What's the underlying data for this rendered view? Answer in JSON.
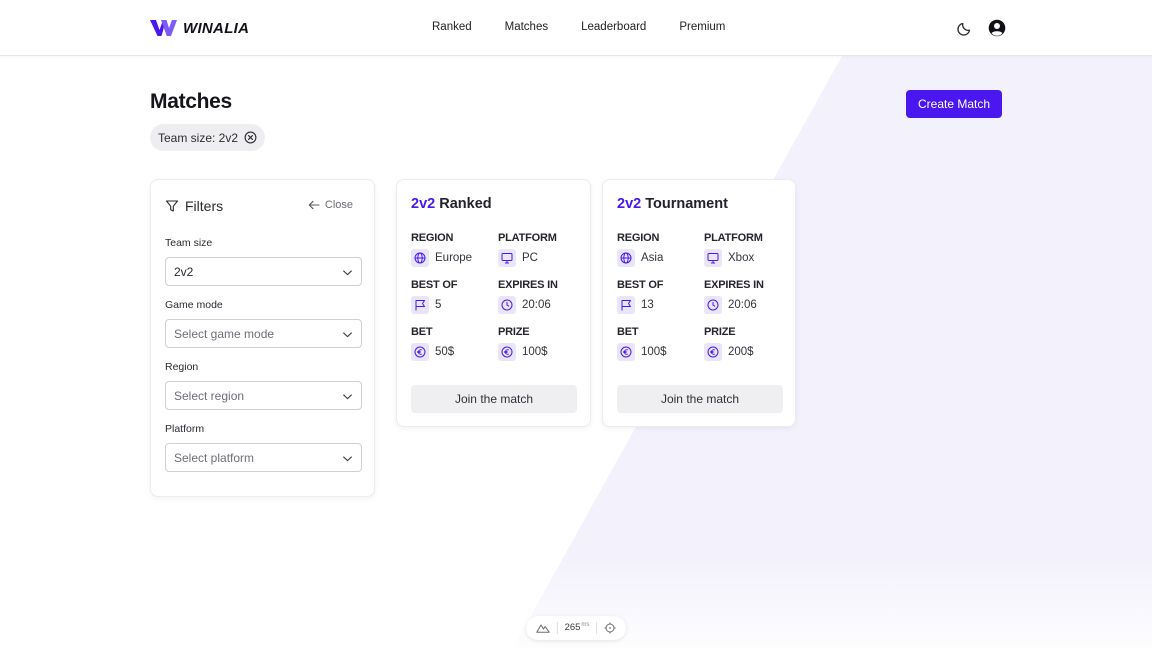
{
  "brand": {
    "name": "WINALIA",
    "accent": "#4a17f0"
  },
  "nav": {
    "items": [
      {
        "label": "Ranked"
      },
      {
        "label": "Matches"
      },
      {
        "label": "Leaderboard"
      },
      {
        "label": "Premium"
      }
    ],
    "active": "Matches"
  },
  "header_icons": [
    "moon-icon",
    "user-account-icon"
  ],
  "page": {
    "title": "Matches",
    "create_button": "Create Match",
    "active_filter_chip": "Team size: 2v2"
  },
  "filters": {
    "title": "Filters",
    "close_label": "Close",
    "fields": [
      {
        "label": "Team size",
        "value": "2v2",
        "placeholder": ""
      },
      {
        "label": "Game mode",
        "value": "",
        "placeholder": "Select game mode"
      },
      {
        "label": "Region",
        "value": "",
        "placeholder": "Select region"
      },
      {
        "label": "Platform",
        "value": "",
        "placeholder": "Select platform"
      }
    ]
  },
  "matches": [
    {
      "team_size": "2v2",
      "mode": "Ranked",
      "region_label": "REGION",
      "region": "Europe",
      "platform_label": "PLATFORM",
      "platform": "PC",
      "best_of_label": "BEST OF",
      "best_of": "5",
      "expires_label": "EXPIRES IN",
      "expires": "20:06",
      "bet_label": "BET",
      "bet": "50$",
      "prize_label": "PRIZE",
      "prize": "100$",
      "join_label": "Join the match"
    },
    {
      "team_size": "2v2",
      "mode": "Tournament",
      "region_label": "REGION",
      "region": "Asia",
      "platform_label": "PLATFORM",
      "platform": "Xbox",
      "best_of_label": "BEST OF",
      "best_of": "13",
      "expires_label": "EXPIRES IN",
      "expires": "20:06",
      "bet_label": "BET",
      "bet": "100$",
      "prize_label": "PRIZE",
      "prize": "200$",
      "join_label": "Join the match"
    }
  ],
  "status_bar": {
    "latency": "265",
    "unit": "ms"
  }
}
